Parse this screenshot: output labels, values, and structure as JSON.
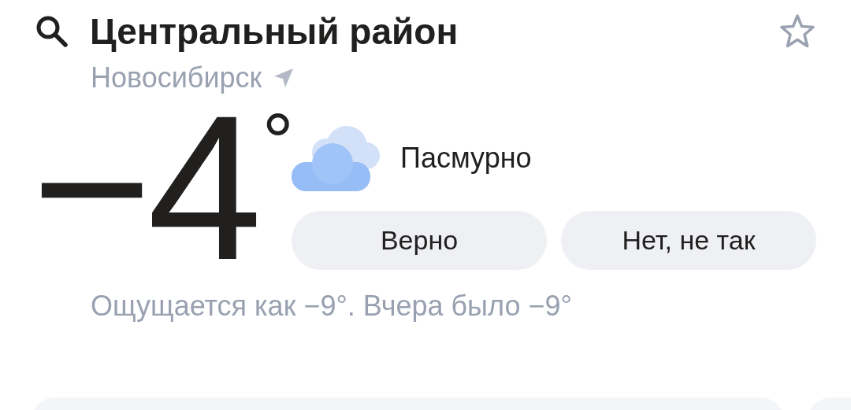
{
  "header": {
    "title": "Центральный район",
    "city": "Новосибирск"
  },
  "current": {
    "temperature": "−4",
    "degree_mark": "°",
    "condition": "Пасмурно"
  },
  "feedback_buttons": [
    {
      "label": "Верно"
    },
    {
      "label": "Нет, не так"
    }
  ],
  "feels_like": "Ощущается как −9°. Вчера было −9°"
}
